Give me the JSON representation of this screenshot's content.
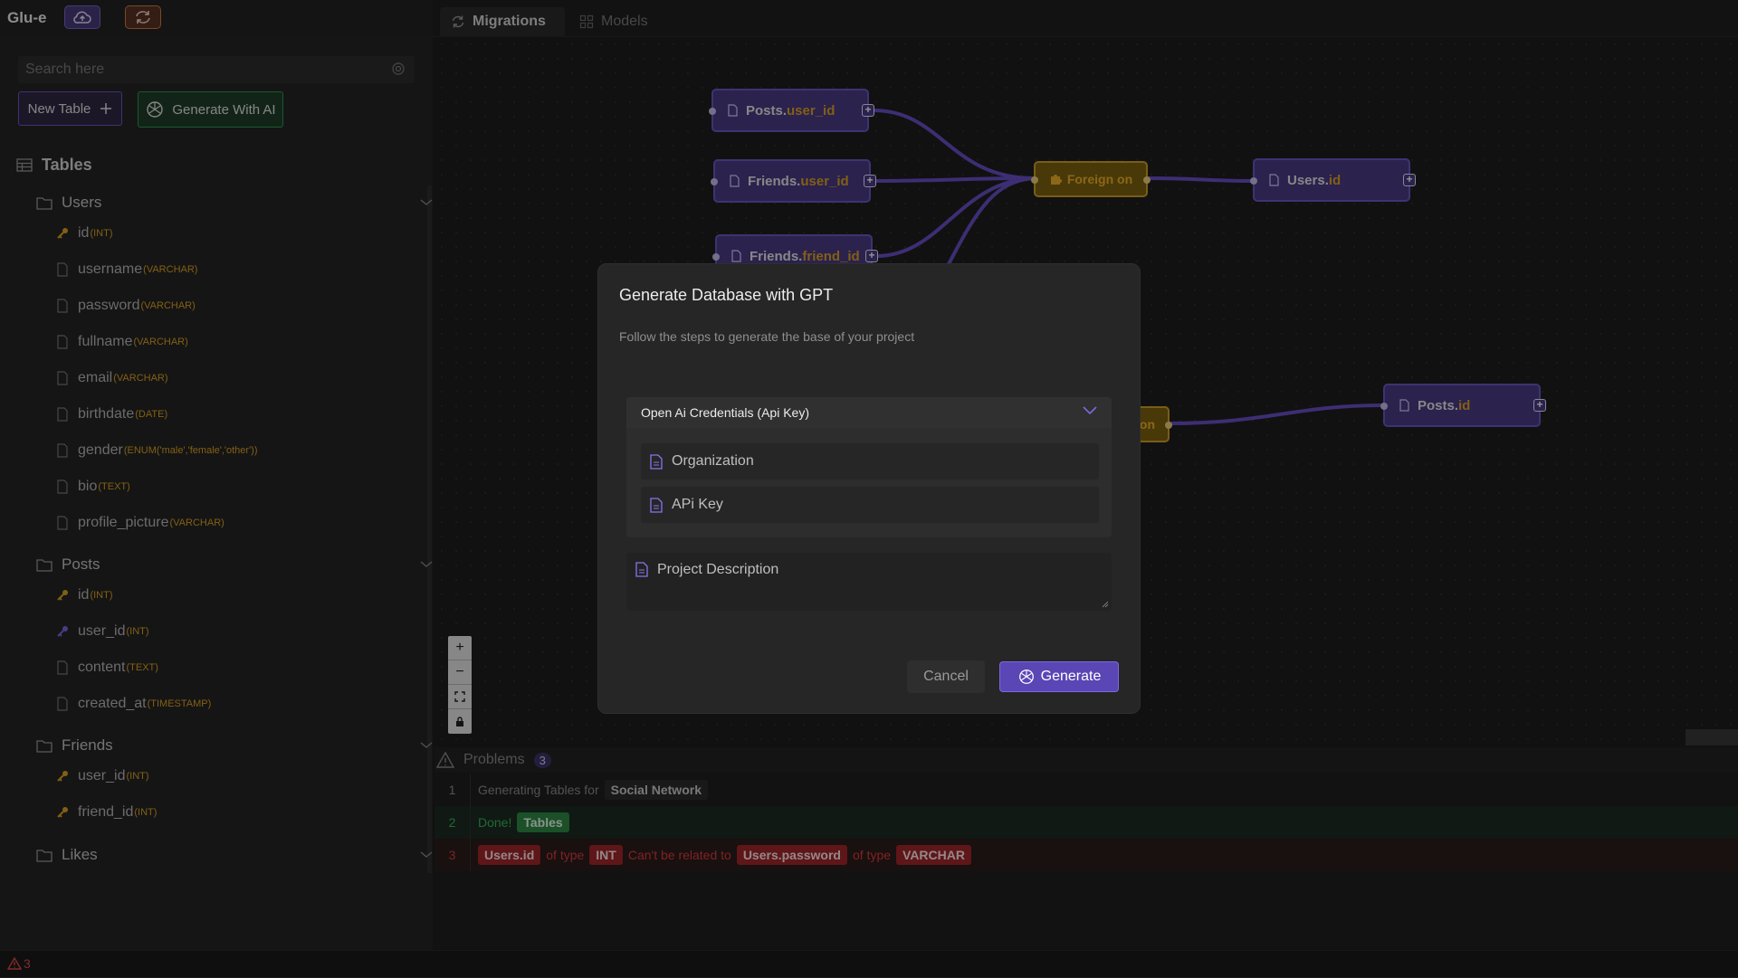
{
  "app": {
    "title": "Glu-e"
  },
  "sidebar": {
    "search_placeholder": "Search here",
    "new_table_label": "New Table",
    "gen_ai_label": "Generate With AI",
    "tables_label": "Tables",
    "tables": [
      {
        "name": "Users",
        "columns": [
          {
            "name": "id",
            "type": "(INT)",
            "key": "primary"
          },
          {
            "name": "username",
            "type": "(VARCHAR)"
          },
          {
            "name": "password",
            "type": "(VARCHAR)"
          },
          {
            "name": "fullname",
            "type": "(VARCHAR)"
          },
          {
            "name": "email",
            "type": "(VARCHAR)"
          },
          {
            "name": "birthdate",
            "type": "(DATE)"
          },
          {
            "name": "gender",
            "type": "(ENUM('male','female','other'))"
          },
          {
            "name": "bio",
            "type": "(TEXT)"
          },
          {
            "name": "profile_picture",
            "type": "(VARCHAR)"
          }
        ]
      },
      {
        "name": "Posts",
        "columns": [
          {
            "name": "id",
            "type": "(INT)",
            "key": "primary"
          },
          {
            "name": "user_id",
            "type": "(INT)",
            "key": "foreign"
          },
          {
            "name": "content",
            "type": "(TEXT)"
          },
          {
            "name": "created_at",
            "type": "(TIMESTAMP)"
          }
        ]
      },
      {
        "name": "Friends",
        "columns": [
          {
            "name": "user_id",
            "type": "(INT)",
            "key": "primary"
          },
          {
            "name": "friend_id",
            "type": "(INT)",
            "key": "primary"
          }
        ]
      },
      {
        "name": "Likes",
        "columns": []
      }
    ]
  },
  "tabs": [
    {
      "label": "Migrations",
      "active": true
    },
    {
      "label": "Models",
      "active": false
    }
  ],
  "canvas": {
    "nodes": [
      {
        "table": "Posts.",
        "field": "user_id"
      },
      {
        "table": "Friends.",
        "field": "user_id"
      },
      {
        "table": "Friends.",
        "field": "friend_id"
      },
      {
        "table": "Users.",
        "field": "id"
      },
      {
        "table": "Posts.",
        "field": "id"
      }
    ],
    "fk_label": "Foreign on",
    "fk_partial_label": "on"
  },
  "dialog": {
    "title": "Generate Database with GPT",
    "subtitle": "Follow the steps to generate the base of your project",
    "credentials_label": "Open Ai Credentials (Api Key)",
    "organization_placeholder": "Organization",
    "api_key_placeholder": "APi Key",
    "description_placeholder": "Project Description",
    "cancel_label": "Cancel",
    "generate_label": "Generate"
  },
  "problems": {
    "label": "Problems",
    "count": "3",
    "rows": [
      {
        "num": "1",
        "text": "Generating Tables for",
        "chip": "Social Network"
      },
      {
        "num": "2",
        "text": "Done!",
        "chip": "Tables"
      },
      {
        "num": "3",
        "chip1": "Users.id",
        "t1": "of type",
        "chip2": "INT",
        "t2": "Can't be related to",
        "chip3": "Users.password",
        "t3": "of type",
        "chip4": "VARCHAR"
      }
    ]
  },
  "status": {
    "problem_count": "3"
  },
  "colors": {
    "accent": "#5a46b4",
    "field": "#e0a424",
    "success": "#2f8a45",
    "error": "#a3262b"
  }
}
